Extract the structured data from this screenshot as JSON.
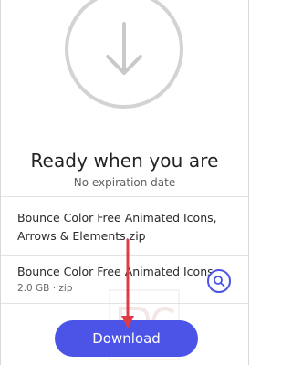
{
  "header": {
    "title": "Ready when you are",
    "subtitle": "No expiration date"
  },
  "transfer": {
    "filename": "Bounce Color Free Animated Icons, Arrows & Elements.zip"
  },
  "file": {
    "name": "Bounce Color Free Animated Icons, Arrows & Elements.zip",
    "meta": "2.0 GB · zip"
  },
  "actions": {
    "download_label": "Download"
  },
  "icons": {
    "hero": "download-arrow-icon",
    "preview": "search-icon"
  },
  "colors": {
    "accent": "#4b54e6",
    "annotation": "#e03a44",
    "circle": "#d3d3d3"
  }
}
